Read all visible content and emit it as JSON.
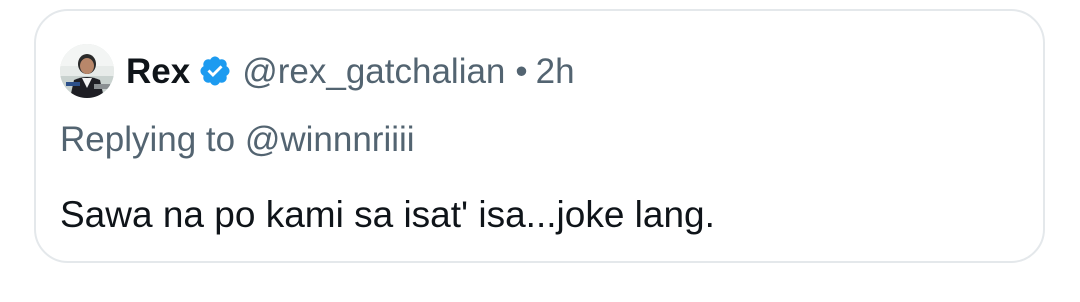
{
  "tweet": {
    "author": {
      "name": "Rex",
      "handle": "@rex_gatchalian",
      "verified": true,
      "verified_color": "#1d9bf0"
    },
    "separator": "•",
    "time": "2h",
    "replying_to": "Replying to @winnnriiii",
    "text": "Sawa na po kami sa isat' isa...joke lang."
  },
  "icons": {
    "verified": "verified-badge-icon",
    "avatar": "user-avatar"
  },
  "colors": {
    "text_primary": "#0f1419",
    "text_secondary": "#536471",
    "border": "#e4e8eb"
  }
}
